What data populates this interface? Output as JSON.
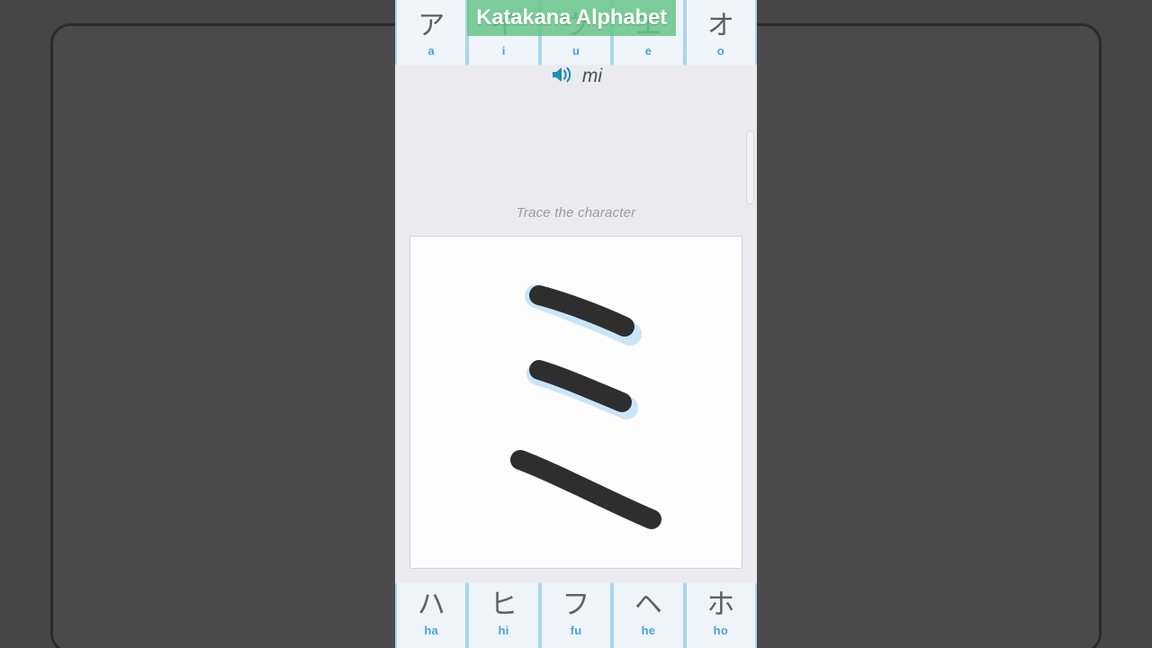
{
  "overlay": {
    "title": "Katakana Alphabet",
    "banner_color": "#68c587",
    "text_color": "#ffffff"
  },
  "app": {
    "background_color": "#eaeaef",
    "accent_color": "#4aa3d6",
    "stroke_color": "#2e2e2e",
    "guide_color": "#c8e4f7"
  },
  "reading": {
    "speaker_icon": "speaker-volume-icon",
    "romaji": "mi"
  },
  "instruction": {
    "text": "Trace the character"
  },
  "top_row": {
    "cells": [
      {
        "kana": "ア",
        "romaji": "a"
      },
      {
        "kana": "イ",
        "romaji": "i"
      },
      {
        "kana": "ウ",
        "romaji": "u"
      },
      {
        "kana": "エ",
        "romaji": "e"
      },
      {
        "kana": "オ",
        "romaji": "o"
      }
    ]
  },
  "bottom_row": {
    "cells": [
      {
        "kana": "ハ",
        "romaji": "ha"
      },
      {
        "kana": "ヒ",
        "romaji": "hi"
      },
      {
        "kana": "フ",
        "romaji": "fu"
      },
      {
        "kana": "ヘ",
        "romaji": "he"
      },
      {
        "kana": "ホ",
        "romaji": "ho"
      }
    ]
  },
  "trace": {
    "character": "ミ",
    "character_romaji": "mi",
    "total_strokes": 3,
    "strokes_drawn": 3,
    "strokes": [
      {
        "index": 1,
        "traced": true,
        "guide_visible": true
      },
      {
        "index": 2,
        "traced": true,
        "guide_visible": true
      },
      {
        "index": 3,
        "traced": true,
        "guide_visible": false
      }
    ]
  },
  "scrollbar": {
    "orientation": "vertical",
    "position_label": "near-top"
  }
}
